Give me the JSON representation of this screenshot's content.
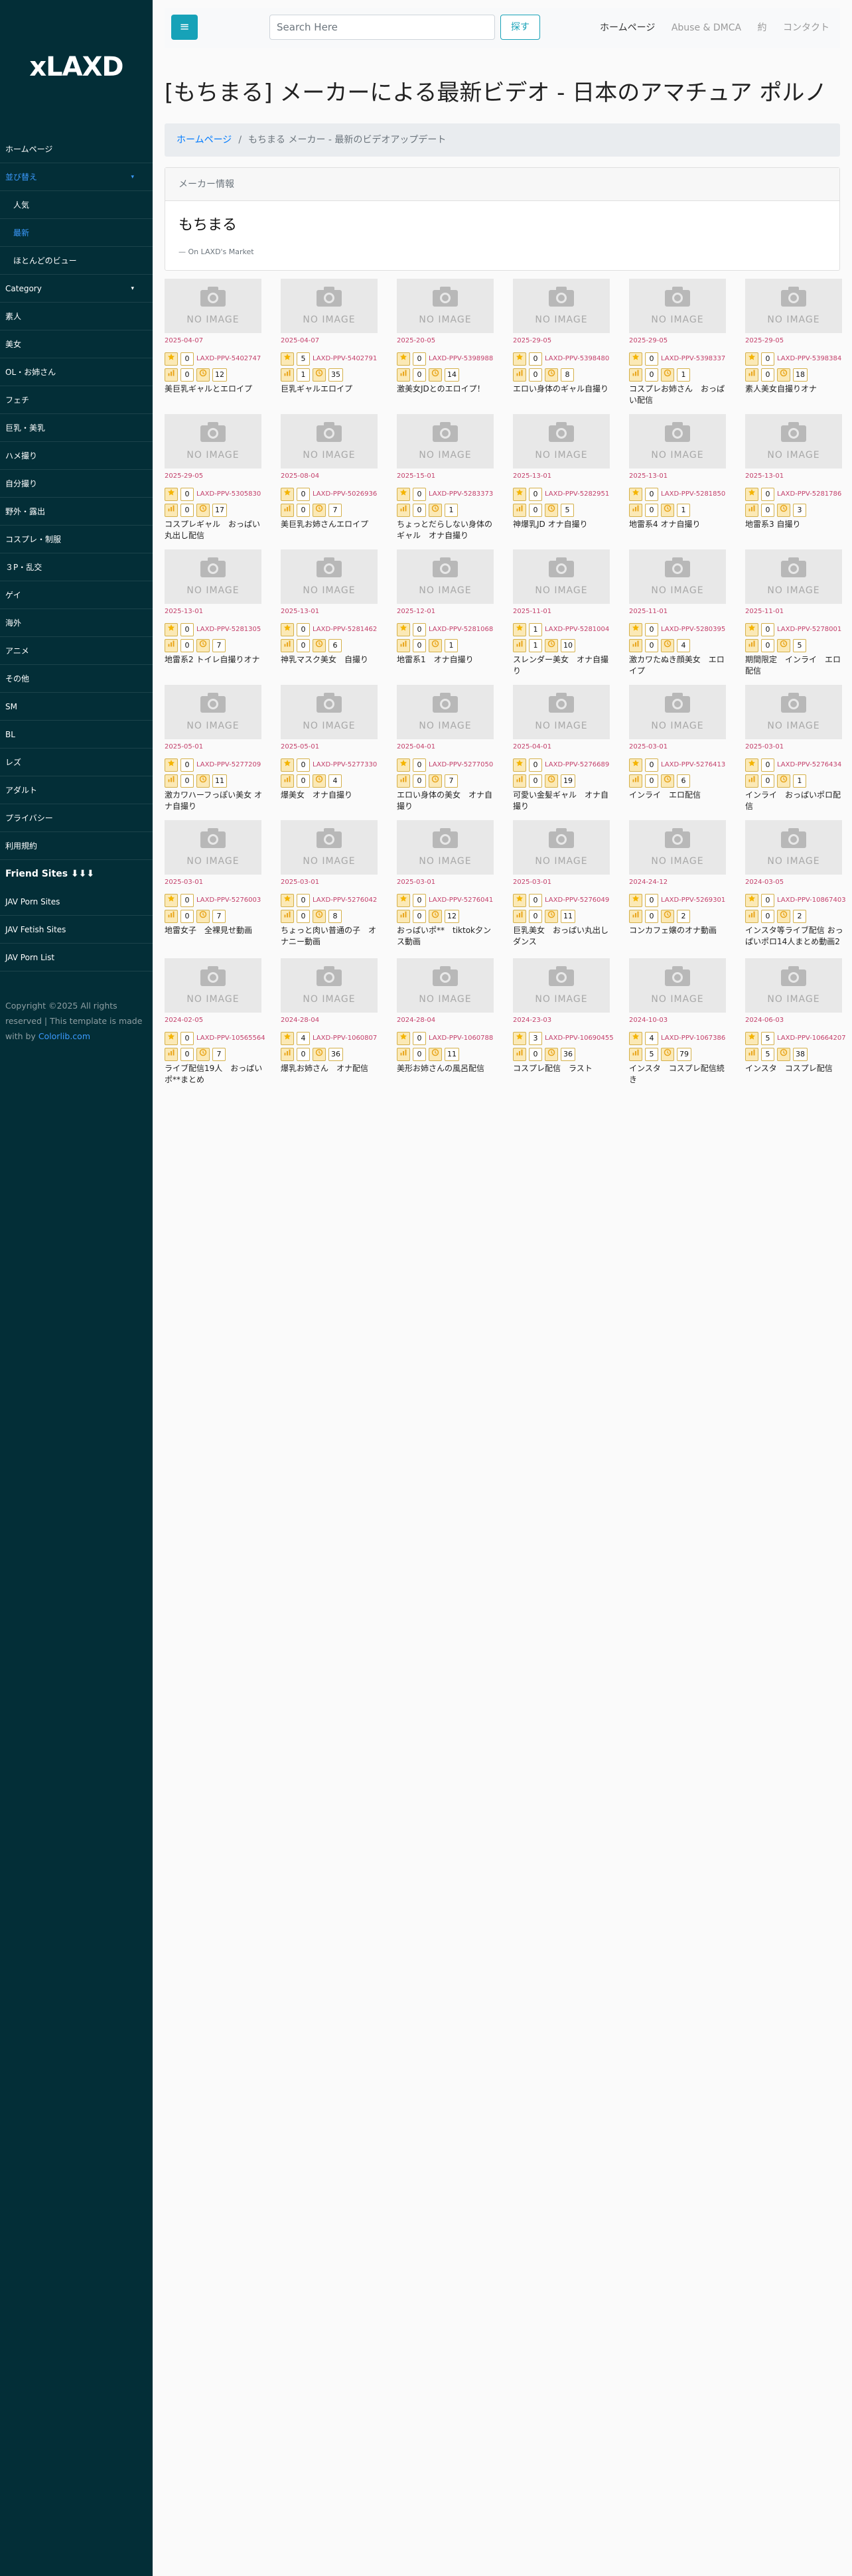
{
  "sidebar": {
    "logo": "xLAXD",
    "items": [
      {
        "label": "ホームページ",
        "type": "top",
        "caret": ""
      },
      {
        "label": "並び替え",
        "type": "top-blue",
        "caret": "▾"
      },
      {
        "label": "人気",
        "type": "sub",
        "caret": ""
      },
      {
        "label": "最新",
        "type": "sub-blue",
        "caret": ""
      },
      {
        "label": "ほとんどのビュー",
        "type": "sub",
        "caret": ""
      },
      {
        "label": "Category",
        "type": "top",
        "caret": "▾"
      },
      {
        "label": "素人",
        "type": "top",
        "caret": ""
      },
      {
        "label": "美女",
        "type": "top",
        "caret": ""
      },
      {
        "label": "OL・お姉さん",
        "type": "top",
        "caret": ""
      },
      {
        "label": "フェチ",
        "type": "top",
        "caret": ""
      },
      {
        "label": "巨乳・美乳",
        "type": "top",
        "caret": ""
      },
      {
        "label": "ハメ撮り",
        "type": "top",
        "caret": ""
      },
      {
        "label": "自分撮り",
        "type": "top",
        "caret": ""
      },
      {
        "label": "野外・露出",
        "type": "top",
        "caret": ""
      },
      {
        "label": "コスプレ・制服",
        "type": "top",
        "caret": ""
      },
      {
        "label": "３P・乱交",
        "type": "top",
        "caret": ""
      },
      {
        "label": "ゲイ",
        "type": "top",
        "caret": ""
      },
      {
        "label": "海外",
        "type": "top",
        "caret": ""
      },
      {
        "label": "アニメ",
        "type": "top",
        "caret": ""
      },
      {
        "label": "その他",
        "type": "top",
        "caret": ""
      },
      {
        "label": "SM",
        "type": "top",
        "caret": ""
      },
      {
        "label": "BL",
        "type": "top",
        "caret": ""
      },
      {
        "label": "レズ",
        "type": "top",
        "caret": ""
      },
      {
        "label": "アダルト",
        "type": "top",
        "caret": ""
      },
      {
        "label": "プライバシー",
        "type": "top",
        "caret": ""
      },
      {
        "label": "利用規約",
        "type": "top",
        "caret": ""
      },
      {
        "label": "Friend Sites ⬇⬇⬇",
        "type": "bold",
        "caret": ""
      },
      {
        "label": "JAV Porn Sites",
        "type": "top",
        "caret": ""
      },
      {
        "label": "JAV Fetish Sites",
        "type": "top",
        "caret": ""
      },
      {
        "label": "JAV Porn List",
        "type": "top",
        "caret": ""
      }
    ],
    "footer_text": "Copyright ©2025 All rights reserved | This template is made with by ",
    "footer_link": "Colorlib.com"
  },
  "header": {
    "toggle_icon": "≡",
    "search_placeholder": "Search Here",
    "search_button": "探す",
    "nav": [
      "ホームページ",
      "Abuse & DMCA",
      "約",
      "コンタクト"
    ]
  },
  "page": {
    "title": "[もちまる] メーカーによる最新ビデオ - 日本のアマチュア ポルノ",
    "breadcrumb_home": "ホームページ",
    "breadcrumb_sep": "/",
    "breadcrumb_current": "もちまる メーカー - 最新のビデオアップデート",
    "card_header": "メーカー情報",
    "card_title": "もちまる",
    "card_sub": "— On LAXD's Market"
  },
  "no_image": "NO IMAGE",
  "icons": {
    "star": "star-icon",
    "chart": "bar-chart-icon",
    "clock": "clock-icon",
    "camera": "camera-icon"
  },
  "colors": {
    "sidebar": "#032e37",
    "accent": "#17a2b8",
    "date": "#c33f6a",
    "link": "#007bff"
  },
  "videos": [
    {
      "date": "2025-04-07",
      "rank": "0",
      "code": "LAXD-PPV-5402747",
      "views": "0",
      "time": "12",
      "name": "美巨乳ギャルとエロイプ"
    },
    {
      "date": "2025-04-07",
      "rank": "5",
      "code": "LAXD-PPV-5402791",
      "views": "1",
      "time": "35",
      "name": "巨乳ギャルエロイプ"
    },
    {
      "date": "2025-20-05",
      "rank": "0",
      "code": "LAXD-PPV-5398988",
      "views": "0",
      "time": "14",
      "name": "激美女JDとのエロイプ！"
    },
    {
      "date": "2025-29-05",
      "rank": "0",
      "code": "LAXD-PPV-5398480",
      "views": "0",
      "time": "8",
      "name": "エロい身体のギャル自撮り"
    },
    {
      "date": "2025-29-05",
      "rank": "0",
      "code": "LAXD-PPV-5398337",
      "views": "0",
      "time": "1",
      "name": "コスプレお姉さん　おっぱい配信"
    },
    {
      "date": "2025-29-05",
      "rank": "0",
      "code": "LAXD-PPV-5398384",
      "views": "0",
      "time": "18",
      "name": "素人美女自撮りオナ"
    },
    {
      "date": "2025-29-05",
      "rank": "0",
      "code": "LAXD-PPV-5305830",
      "views": "0",
      "time": "17",
      "name": "コスプレギャル　おっぱい丸出し配信"
    },
    {
      "date": "2025-08-04",
      "rank": "0",
      "code": "LAXD-PPV-5026936",
      "views": "0",
      "time": "7",
      "name": "美巨乳お姉さんエロイプ"
    },
    {
      "date": "2025-15-01",
      "rank": "0",
      "code": "LAXD-PPV-5283373",
      "views": "0",
      "time": "1",
      "name": "ちょっとだらしない身体のギャル　オナ自撮り"
    },
    {
      "date": "2025-13-01",
      "rank": "0",
      "code": "LAXD-PPV-5282951",
      "views": "0",
      "time": "5",
      "name": "神爆乳JD オナ自撮り"
    },
    {
      "date": "2025-13-01",
      "rank": "0",
      "code": "LAXD-PPV-5281850",
      "views": "0",
      "time": "1",
      "name": "地雷系4 オナ自撮り"
    },
    {
      "date": "2025-13-01",
      "rank": "0",
      "code": "LAXD-PPV-5281786",
      "views": "0",
      "time": "3",
      "name": "地雷系3 自撮り"
    },
    {
      "date": "2025-13-01",
      "rank": "0",
      "code": "LAXD-PPV-5281305",
      "views": "0",
      "time": "7",
      "name": "地雷系2 トイレ自撮りオナ"
    },
    {
      "date": "2025-13-01",
      "rank": "0",
      "code": "LAXD-PPV-5281462",
      "views": "0",
      "time": "6",
      "name": "神乳マスク美女　自撮り"
    },
    {
      "date": "2025-12-01",
      "rank": "0",
      "code": "LAXD-PPV-5281068",
      "views": "0",
      "time": "1",
      "name": "地雷系1　オナ自撮り"
    },
    {
      "date": "2025-11-01",
      "rank": "1",
      "code": "LAXD-PPV-5281004",
      "views": "1",
      "time": "10",
      "name": "スレンダー美女　オナ自撮り"
    },
    {
      "date": "2025-11-01",
      "rank": "0",
      "code": "LAXD-PPV-5280395",
      "views": "0",
      "time": "4",
      "name": "激カワたぬき顔美女　エロイプ"
    },
    {
      "date": "2025-11-01",
      "rank": "0",
      "code": "LAXD-PPV-5278001",
      "views": "0",
      "time": "5",
      "name": "期間限定　インライ　エロ配信"
    },
    {
      "date": "2025-05-01",
      "rank": "0",
      "code": "LAXD-PPV-5277209",
      "views": "0",
      "time": "11",
      "name": "激カワハーフっぽい美女 オナ自撮り"
    },
    {
      "date": "2025-05-01",
      "rank": "0",
      "code": "LAXD-PPV-5277330",
      "views": "0",
      "time": "4",
      "name": "爆美女　オナ自撮り"
    },
    {
      "date": "2025-04-01",
      "rank": "0",
      "code": "LAXD-PPV-5277050",
      "views": "0",
      "time": "7",
      "name": "エロい身体の美女　オナ自撮り"
    },
    {
      "date": "2025-04-01",
      "rank": "0",
      "code": "LAXD-PPV-5276689",
      "views": "0",
      "time": "19",
      "name": "可愛い金髪ギャル　オナ自撮り"
    },
    {
      "date": "2025-03-01",
      "rank": "0",
      "code": "LAXD-PPV-5276413",
      "views": "0",
      "time": "6",
      "name": "インライ　エロ配信"
    },
    {
      "date": "2025-03-01",
      "rank": "0",
      "code": "LAXD-PPV-5276434",
      "views": "0",
      "time": "1",
      "name": "インライ　おっぱいポロ配信"
    },
    {
      "date": "2025-03-01",
      "rank": "0",
      "code": "LAXD-PPV-5276003",
      "views": "0",
      "time": "7",
      "name": "地雷女子　全裸見せ動画"
    },
    {
      "date": "2025-03-01",
      "rank": "0",
      "code": "LAXD-PPV-5276042",
      "views": "0",
      "time": "8",
      "name": "ちょっと肉い普通の子　オナニー動画"
    },
    {
      "date": "2025-03-01",
      "rank": "0",
      "code": "LAXD-PPV-5276041",
      "views": "0",
      "time": "12",
      "name": "おっぱいポ**　tiktok夕ンス動画"
    },
    {
      "date": "2025-03-01",
      "rank": "0",
      "code": "LAXD-PPV-5276049",
      "views": "0",
      "time": "11",
      "name": "巨乳美女　おっぱい丸出しダンス"
    },
    {
      "date": "2024-24-12",
      "rank": "0",
      "code": "LAXD-PPV-5269301",
      "views": "0",
      "time": "2",
      "name": "コンカフェ嬢のオナ動画"
    },
    {
      "date": "2024-03-05",
      "rank": "0",
      "code": "LAXD-PPV-10867403",
      "views": "0",
      "time": "2",
      "name": "インスタ等ライブ配信 おっぱいポロ14人まとめ動画2"
    },
    {
      "date": "2024-02-05",
      "rank": "0",
      "code": "LAXD-PPV-10565564",
      "views": "0",
      "time": "7",
      "name": "ライブ配信19人　おっぱいポ**まとめ"
    },
    {
      "date": "2024-28-04",
      "rank": "4",
      "code": "LAXD-PPV-1060807",
      "views": "0",
      "time": "36",
      "name": "爆乳お姉さん　オナ配信"
    },
    {
      "date": "2024-28-04",
      "rank": "0",
      "code": "LAXD-PPV-1060788",
      "views": "0",
      "time": "11",
      "name": "美形お姉さんの風呂配信"
    },
    {
      "date": "2024-23-03",
      "rank": "3",
      "code": "LAXD-PPV-10690455",
      "views": "0",
      "time": "36",
      "name": "コスプレ配信　ラスト"
    },
    {
      "date": "2024-10-03",
      "rank": "4",
      "code": "LAXD-PPV-1067386",
      "views": "5",
      "time": "79",
      "name": "インスタ　コスプレ配信続き"
    },
    {
      "date": "2024-06-03",
      "rank": "5",
      "code": "LAXD-PPV-10664207",
      "views": "5",
      "time": "38",
      "name": "インスタ　コスプレ配信"
    }
  ]
}
